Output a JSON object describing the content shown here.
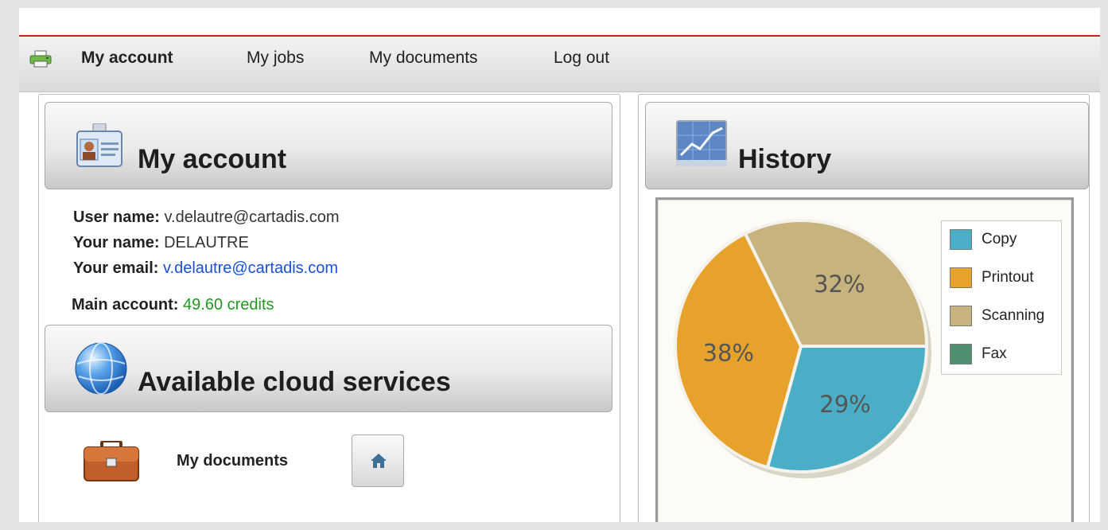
{
  "nav": {
    "items": [
      {
        "label": "My account",
        "active": true
      },
      {
        "label": "My jobs",
        "active": false
      },
      {
        "label": "My documents",
        "active": false
      },
      {
        "label": "Log out",
        "active": false
      }
    ]
  },
  "account": {
    "title": "My account",
    "user_name_label": "User name:",
    "user_name": "v.delautre@cartadis.com",
    "your_name_label": "Your name:",
    "your_name": "DELAUTRE",
    "email_label": "Your email:",
    "email": "v.delautre@cartadis.com",
    "main_account_label": "Main account:",
    "credits_value": "49.60",
    "credits_unit": "credits"
  },
  "cloud": {
    "title": "Available cloud services",
    "services": [
      {
        "label": "My documents",
        "icon": "briefcase-icon",
        "button_icon": "home-icon"
      }
    ]
  },
  "history": {
    "title": "History"
  },
  "chart_data": {
    "type": "pie",
    "series": [
      {
        "name": "Copy",
        "value": 29,
        "label": "29%",
        "color": "#4aafc6"
      },
      {
        "name": "Printout",
        "value": 38,
        "label": "38%",
        "color": "#e7a22b"
      },
      {
        "name": "Scanning",
        "value": 32,
        "label": "32%",
        "color": "#c6b37e"
      },
      {
        "name": "Fax",
        "value": 0,
        "label": "",
        "color": "#4f8f70"
      }
    ],
    "legend": [
      "Copy",
      "Printout",
      "Scanning",
      "Fax"
    ],
    "legend_position": "top-right"
  },
  "colors": {
    "accent_red": "#d21c1c",
    "link_blue": "#1a4fd6",
    "credit_green": "#1f9a1f"
  }
}
